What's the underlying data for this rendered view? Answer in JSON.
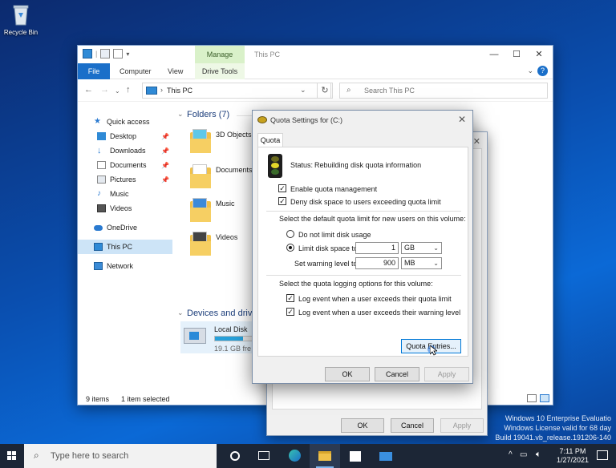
{
  "desktop": {
    "recycle_bin_label": "Recycle Bin"
  },
  "explorer": {
    "title": "This PC",
    "manage_tab": "Manage",
    "ribbon_tabs": {
      "file": "File",
      "computer": "Computer",
      "view": "View",
      "drive_tools": "Drive Tools"
    },
    "address_path": "This PC",
    "search_placeholder": "Search This PC",
    "sidebar": {
      "quick_access": "Quick access",
      "desktop": "Desktop",
      "downloads": "Downloads",
      "documents": "Documents",
      "pictures": "Pictures",
      "music": "Music",
      "videos": "Videos",
      "onedrive": "OneDrive",
      "this_pc": "This PC",
      "network": "Network"
    },
    "folders_header": "Folders (7)",
    "folders": {
      "objects3d": "3D Objects",
      "documents": "Documents",
      "music": "Music",
      "videos": "Videos"
    },
    "devices_header": "Devices and driv",
    "drive_name": "Local Disk",
    "drive_free": "19.1 GB fre",
    "drive_used_fraction": 0.6,
    "status_items": "9 items",
    "status_selected": "1 item selected"
  },
  "properties_dialog": {
    "ok": "OK",
    "cancel": "Cancel",
    "apply": "Apply"
  },
  "quota_dialog": {
    "title": "Quota Settings for  (C:)",
    "tab": "Quota",
    "status_label": "Status:",
    "status_text": "Rebuilding disk quota information",
    "enable_quota": "Enable quota management",
    "enable_quota_checked": true,
    "deny_space": "Deny disk space to users exceeding quota limit",
    "deny_space_checked": true,
    "default_limit_label": "Select the default quota limit for new users on this volume:",
    "no_limit": "Do not limit disk usage",
    "limit_to": "Limit disk space to",
    "limit_value": "1",
    "limit_unit": "GB",
    "warning_label": "Set warning level to",
    "warning_value": "900",
    "warning_unit": "MB",
    "logging_label": "Select the quota logging options for this volume:",
    "log_limit": "Log event when a user exceeds their quota limit",
    "log_limit_checked": true,
    "log_warning": "Log event when a user exceeds their warning level",
    "log_warning_checked": true,
    "quota_entries": "Quota Entries...",
    "ok": "OK",
    "cancel": "Cancel",
    "apply": "Apply"
  },
  "taskbar": {
    "search_placeholder": "Type here to search",
    "time": "7:11 PM",
    "date": "1/27/2021"
  },
  "watermark": {
    "line1": "Windows 10 Enterprise Evaluatio",
    "line2": "Windows License valid for 68 day",
    "line3": "Build 19041.vb_release.191206-140"
  },
  "colors": {
    "accent": "#1a6fc9",
    "manage_green": "#d9f1c9",
    "taskbar": "#1c2636"
  }
}
